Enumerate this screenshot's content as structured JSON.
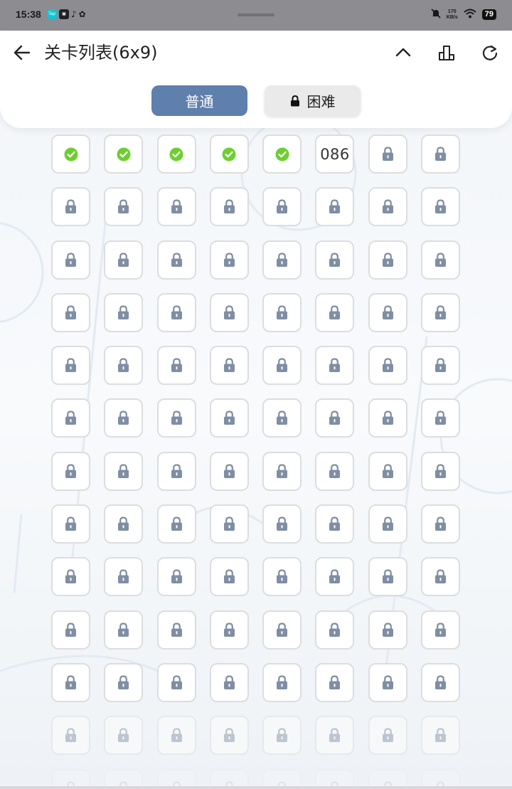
{
  "status_bar": {
    "time": "15:38",
    "apps": [
      "Tap",
      "app",
      "tiktok",
      "wechat"
    ],
    "net_speed_value": "170",
    "net_speed_unit": "KB/s",
    "battery": "79"
  },
  "header": {
    "title": "关卡列表(6x9)",
    "back_icon": "arrow-left-icon",
    "collapse_icon": "chevron-up-icon",
    "ranking_icon": "podium-icon",
    "refresh_icon": "refresh-icon"
  },
  "tabs": [
    {
      "label": "普通",
      "selected": true
    },
    {
      "label": "困难",
      "selected": false,
      "locked": true
    }
  ],
  "colors": {
    "accent": "#5f7fad",
    "completed": "#6ccf2e",
    "lock": "#7f8ea3",
    "cell_border": "#dcdde0"
  },
  "levels": {
    "columns": 8,
    "completed_count": 5,
    "current_level_label": "086",
    "visible_rows": 12,
    "partial_rows": 1
  }
}
